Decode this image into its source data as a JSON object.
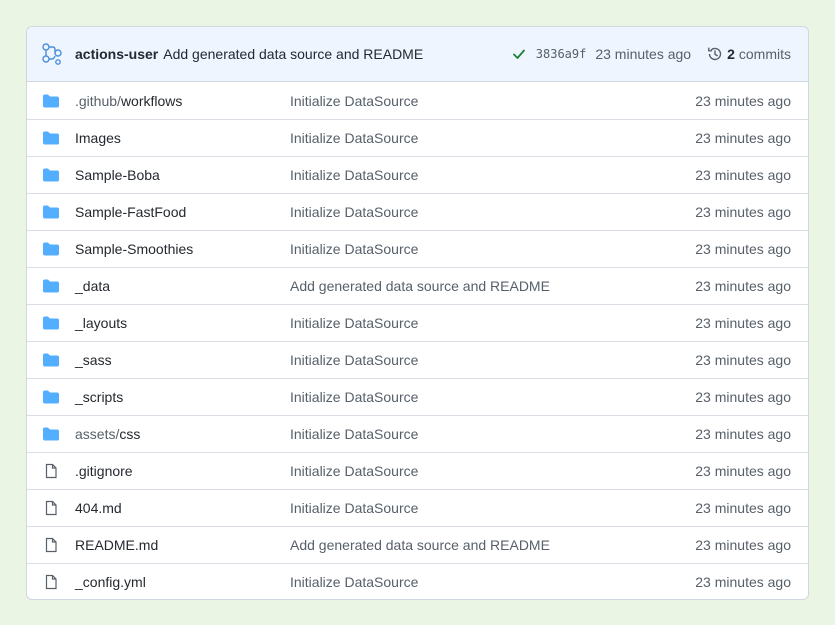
{
  "header": {
    "avatar_icon": "github-actions-icon",
    "author": "actions-user",
    "message": "Add generated data source and README",
    "status_icon": "check-icon",
    "sha": "3836a9f",
    "time": "23 minutes ago",
    "history_icon": "history-icon",
    "commit_count": "2",
    "commits_label": "commits"
  },
  "files": [
    {
      "type": "folder",
      "prefix": ".github/",
      "name": "workflows",
      "message": "Initialize DataSource",
      "time": "23 minutes ago"
    },
    {
      "type": "folder",
      "prefix": "",
      "name": "Images",
      "message": "Initialize DataSource",
      "time": "23 minutes ago"
    },
    {
      "type": "folder",
      "prefix": "",
      "name": "Sample-Boba",
      "message": "Initialize DataSource",
      "time": "23 minutes ago"
    },
    {
      "type": "folder",
      "prefix": "",
      "name": "Sample-FastFood",
      "message": "Initialize DataSource",
      "time": "23 minutes ago"
    },
    {
      "type": "folder",
      "prefix": "",
      "name": "Sample-Smoothies",
      "message": "Initialize DataSource",
      "time": "23 minutes ago"
    },
    {
      "type": "folder",
      "prefix": "",
      "name": "_data",
      "message": "Add generated data source and README",
      "time": "23 minutes ago"
    },
    {
      "type": "folder",
      "prefix": "",
      "name": "_layouts",
      "message": "Initialize DataSource",
      "time": "23 minutes ago"
    },
    {
      "type": "folder",
      "prefix": "",
      "name": "_sass",
      "message": "Initialize DataSource",
      "time": "23 minutes ago"
    },
    {
      "type": "folder",
      "prefix": "",
      "name": "_scripts",
      "message": "Initialize DataSource",
      "time": "23 minutes ago"
    },
    {
      "type": "folder",
      "prefix": "assets/",
      "name": "css",
      "message": "Initialize DataSource",
      "time": "23 minutes ago"
    },
    {
      "type": "file",
      "prefix": "",
      "name": ".gitignore",
      "message": "Initialize DataSource",
      "time": "23 minutes ago"
    },
    {
      "type": "file",
      "prefix": "",
      "name": "404.md",
      "message": "Initialize DataSource",
      "time": "23 minutes ago"
    },
    {
      "type": "file",
      "prefix": "",
      "name": "README.md",
      "message": "Add generated data source and README",
      "time": "23 minutes ago"
    },
    {
      "type": "file",
      "prefix": "",
      "name": "_config.yml",
      "message": "Initialize DataSource",
      "time": "23 minutes ago"
    }
  ],
  "colors": {
    "folder": "#54aeff",
    "file_icon": "#57606a",
    "check": "#1a7f37",
    "header_bg": "#eef5ff",
    "page_bg": "#eaf5e3"
  }
}
